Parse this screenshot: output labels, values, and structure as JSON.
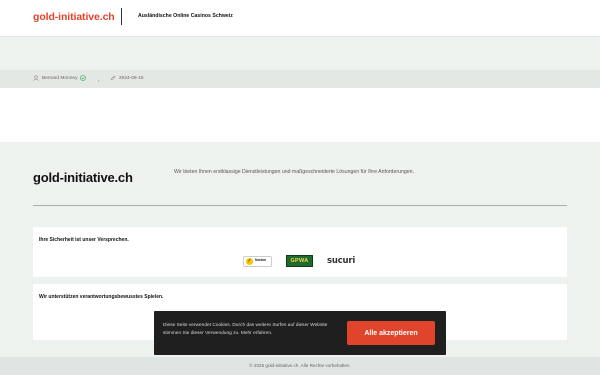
{
  "header": {
    "logo": "gold-initiative.ch",
    "page_title": "Ausländische Online Casinos Schweiz"
  },
  "article_meta": {
    "author": "Bernard Monney",
    "separator": ",",
    "date": "2024-09-15",
    "icons": [
      "user-icon",
      "verified-check-icon",
      "pencil-icon"
    ]
  },
  "footer": {
    "brand": "gold-initiative.ch",
    "description": "Wir bieten Ihnen erstklassige Dienstleistungen und maßgeschneiderte Lösungen für Ihre Anforderungen.",
    "security_card": {
      "title": "Ihre Sicherheit ist unser Versprechen.",
      "badges": {
        "norton": "Norton",
        "gpwa": "GPWA",
        "sucuri": "sucuri"
      }
    },
    "responsible_card": {
      "title": "Wir unterstützen verantwortungsbewusstes Spielen."
    },
    "copyright": "© 2025 gold-initiative.ch. Alle Rechte vorbehalten."
  },
  "cookie_banner": {
    "text": "Diese Seite verwendet Cookies. Durch das weitere Surfen auf dieser Website stimmen Sie dieser Verwendung zu. Mehr erfahren.",
    "accept_label": "Alle akzeptieren"
  },
  "colors": {
    "accent": "#e0442a",
    "page_background": "#edf2ef",
    "cookie_background": "#1f1f1f",
    "verified": "#2fa84f"
  }
}
